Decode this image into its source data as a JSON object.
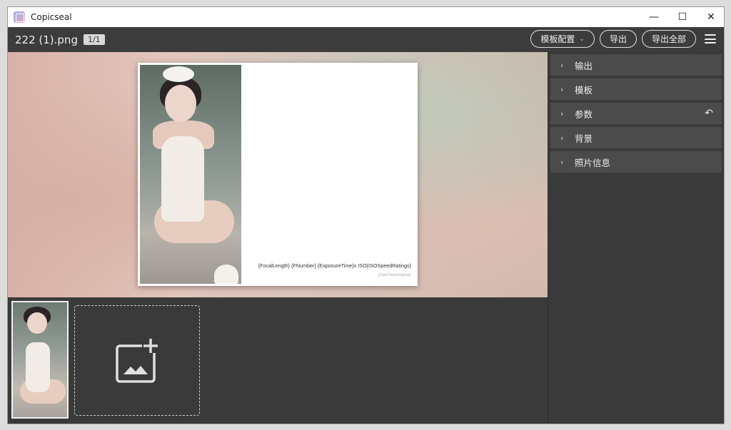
{
  "window": {
    "app_title": "Copicseal",
    "controls": {
      "minimize": "—",
      "maximize": "☐",
      "close": "✕"
    }
  },
  "toolbar": {
    "file_name": "222 (1).png",
    "page_indicator": "1/1",
    "template_config_label": "模板配置",
    "template_config_chevron": "⌄",
    "export_label": "导出",
    "export_all_label": "导出全部",
    "menu_icon": "hamburger-menu-icon"
  },
  "preview": {
    "exif_line": "{FocalLength} {FNumber} {ExposureTime}s ISO{ISOSpeedRatings}",
    "exif_date": "{DateTimeOriginal}"
  },
  "thumbnails": {
    "add_image_icon": "add-image-icon"
  },
  "panel": {
    "sections": [
      {
        "label": "输出",
        "arrow": "›"
      },
      {
        "label": "模板",
        "arrow": "›"
      },
      {
        "label": "参数",
        "arrow": "›",
        "reset_icon": "↶"
      },
      {
        "label": "背景",
        "arrow": "›"
      },
      {
        "label": "照片信息",
        "arrow": "›"
      }
    ]
  },
  "colors": {
    "window_bg": "#3a3a3a",
    "section_bg": "#4b4b4b",
    "titlebar_bg": "#ffffff"
  }
}
